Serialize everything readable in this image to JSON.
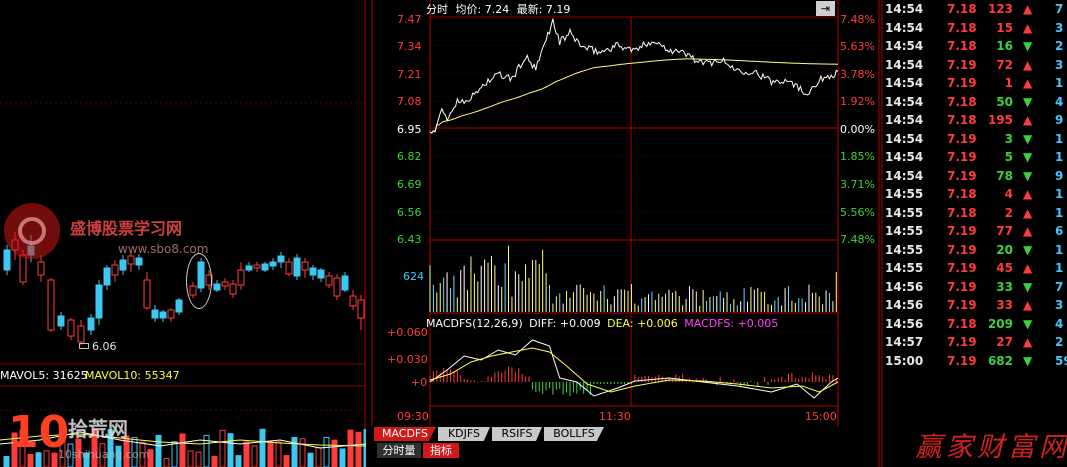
{
  "left_panel": {
    "price_label": "6.06",
    "watermark_site": "盛博股票学习网",
    "watermark_url": "www.sbo8.com",
    "mavol5_label": "MAVOL5: 31625",
    "mavol10_label": "MAVOL10: 55347",
    "logo_number": "10",
    "logo_text": "拾荒网",
    "logo_url": "10shihuang.com"
  },
  "chart": {
    "header_label": "分时",
    "avg_label": "均价: 7.24",
    "last_label": "最新: 7.19",
    "price_ticks_left": [
      "7.47",
      "7.34",
      "7.21",
      "7.08",
      "6.95",
      "6.82",
      "6.69",
      "6.56",
      "6.43"
    ],
    "pct_ticks_right": [
      "7.48%",
      "5.63%",
      "3.78%",
      "1.92%",
      "0.00%",
      "1.85%",
      "3.71%",
      "5.56%",
      "7.48%"
    ],
    "volume_max_label": "624",
    "macd_legend": {
      "name": "MACDFS(12,26,9)",
      "diff": "DIFF: +0.009",
      "dea": "DEA: +0.006",
      "macd": "MACDFS: +0.005"
    },
    "macd_axis": [
      "+0.060",
      "+0.030",
      "+0"
    ],
    "time_labels": [
      "09:30",
      "11:30",
      "15:00"
    ]
  },
  "indicator_tabs": [
    "MACDFS",
    "KDJFS",
    "RSIFS",
    "BOLLFS"
  ],
  "bottom_tabs": [
    "分时量",
    "指标"
  ],
  "ticks": [
    {
      "time": "14:54",
      "price": "7.18",
      "vol": "123",
      "dir": "up",
      "n": "7"
    },
    {
      "time": "14:54",
      "price": "7.18",
      "vol": "15",
      "dir": "up",
      "n": "3"
    },
    {
      "time": "14:54",
      "price": "7.18",
      "vol": "16",
      "dir": "down",
      "n": "2"
    },
    {
      "time": "14:54",
      "price": "7.19",
      "vol": "72",
      "dir": "up",
      "n": "3"
    },
    {
      "time": "14:54",
      "price": "7.19",
      "vol": "1",
      "dir": "up",
      "n": "1"
    },
    {
      "time": "14:54",
      "price": "7.18",
      "vol": "50",
      "dir": "down",
      "n": "4"
    },
    {
      "time": "14:54",
      "price": "7.18",
      "vol": "195",
      "dir": "up",
      "n": "9"
    },
    {
      "time": "14:54",
      "price": "7.19",
      "vol": "3",
      "dir": "down",
      "n": "1"
    },
    {
      "time": "14:54",
      "price": "7.19",
      "vol": "5",
      "dir": "down",
      "n": "1"
    },
    {
      "time": "14:54",
      "price": "7.19",
      "vol": "78",
      "dir": "down",
      "n": "9"
    },
    {
      "time": "14:55",
      "price": "7.18",
      "vol": "4",
      "dir": "up",
      "n": "1"
    },
    {
      "time": "14:55",
      "price": "7.18",
      "vol": "2",
      "dir": "up",
      "n": "1"
    },
    {
      "time": "14:55",
      "price": "7.19",
      "vol": "77",
      "dir": "up",
      "n": "6"
    },
    {
      "time": "14:55",
      "price": "7.19",
      "vol": "20",
      "dir": "down",
      "n": "1"
    },
    {
      "time": "14:55",
      "price": "7.19",
      "vol": "45",
      "dir": "up",
      "n": "1"
    },
    {
      "time": "14:56",
      "price": "7.19",
      "vol": "33",
      "dir": "down",
      "n": "7"
    },
    {
      "time": "14:56",
      "price": "7.19",
      "vol": "33",
      "dir": "up",
      "n": "3"
    },
    {
      "time": "14:56",
      "price": "7.18",
      "vol": "209",
      "dir": "down",
      "n": "4"
    },
    {
      "time": "14:57",
      "price": "7.19",
      "vol": "27",
      "dir": "up",
      "n": "2"
    },
    {
      "time": "15:00",
      "price": "7.19",
      "vol": "682",
      "dir": "down",
      "n": "59"
    }
  ],
  "footer_brand": "赢家财富网",
  "colors": {
    "up": "#ff3b3b",
    "down": "#3bd33b",
    "grid": "#8b0000",
    "frame": "#b00000",
    "price_line": "#ffffff",
    "avg_line": "#ffff80",
    "candle_up": "#ff3b3b",
    "candle_down": "#3cc8f0"
  }
}
